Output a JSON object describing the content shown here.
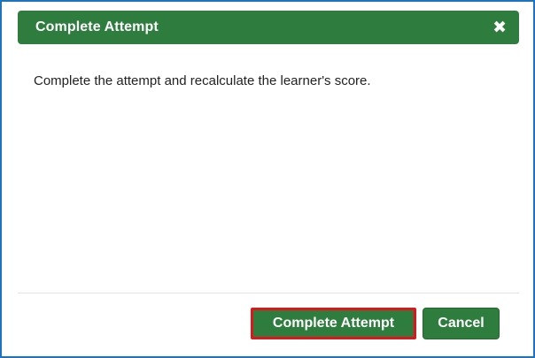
{
  "dialog": {
    "title": "Complete Attempt",
    "close_icon": "close-icon",
    "message": "Complete the attempt and recalculate the learner's score."
  },
  "footer": {
    "complete_label": "Complete Attempt",
    "cancel_label": "Cancel"
  },
  "colors": {
    "header_bg": "#2e7d3e",
    "button_bg": "#2e7d3e",
    "highlight_border": "#e0141b",
    "frame_border": "#1e73be"
  }
}
